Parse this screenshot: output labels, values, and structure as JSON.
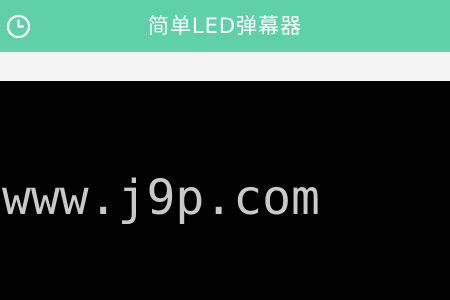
{
  "header": {
    "title": "简单LED弹幕器",
    "history_icon": "clock-history-icon",
    "background_color": "#5fd0a8",
    "text_color": "#ffffff"
  },
  "led": {
    "text": "www.j9p.com",
    "background_color": "#000000",
    "text_color": "#c9c9c9"
  }
}
